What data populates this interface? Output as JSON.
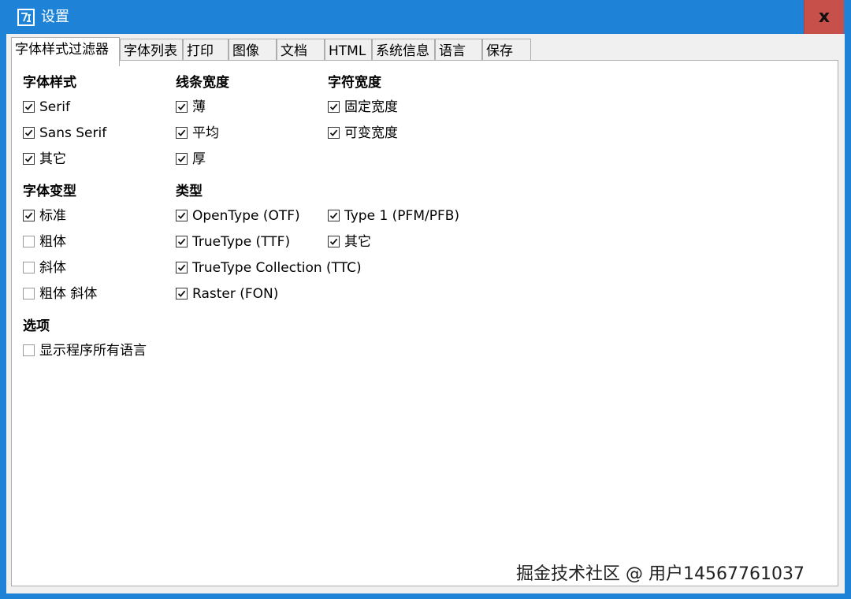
{
  "window": {
    "title": "设置",
    "close_label": "x"
  },
  "tabs": [
    {
      "label": "字体样式过滤器"
    },
    {
      "label": "字体列表"
    },
    {
      "label": "打印"
    },
    {
      "label": "图像"
    },
    {
      "label": "文档"
    },
    {
      "label": "HTML"
    },
    {
      "label": "系统信息"
    },
    {
      "label": "语言"
    },
    {
      "label": "保存"
    }
  ],
  "groups": {
    "font_style": {
      "title": "字体样式",
      "items": [
        {
          "label": "Serif",
          "checked": true
        },
        {
          "label": "Sans Serif",
          "checked": true
        },
        {
          "label": "其它",
          "checked": true
        }
      ]
    },
    "line_width": {
      "title": "线条宽度",
      "items": [
        {
          "label": "薄",
          "checked": true
        },
        {
          "label": "平均",
          "checked": true
        },
        {
          "label": "厚",
          "checked": true
        }
      ]
    },
    "char_width": {
      "title": "字符宽度",
      "items": [
        {
          "label": "固定宽度",
          "checked": true
        },
        {
          "label": "可变宽度",
          "checked": true
        }
      ]
    },
    "font_variant": {
      "title": "字体变型",
      "items": [
        {
          "label": "标准",
          "checked": true
        },
        {
          "label": "粗体",
          "checked": false
        },
        {
          "label": "斜体",
          "checked": false
        },
        {
          "label": "粗体 斜体",
          "checked": false
        }
      ]
    },
    "type": {
      "title": "类型",
      "items": [
        {
          "label": "OpenType (OTF)",
          "checked": true
        },
        {
          "label": "TrueType (TTF)",
          "checked": true
        },
        {
          "label": "TrueType Collection (TTC)",
          "checked": true
        },
        {
          "label": "Raster (FON)",
          "checked": true
        },
        {
          "label": "Type 1 (PFM/PFB)",
          "checked": true
        },
        {
          "label": "其它",
          "checked": true
        }
      ]
    },
    "options": {
      "title": "选项",
      "items": [
        {
          "label": "显示程序所有语言",
          "checked": false
        }
      ]
    }
  },
  "watermark": "掘金技术社区 @ 用户14567761037",
  "colors": {
    "titlebar": "#1e83d6",
    "close_button": "#c8504b"
  }
}
